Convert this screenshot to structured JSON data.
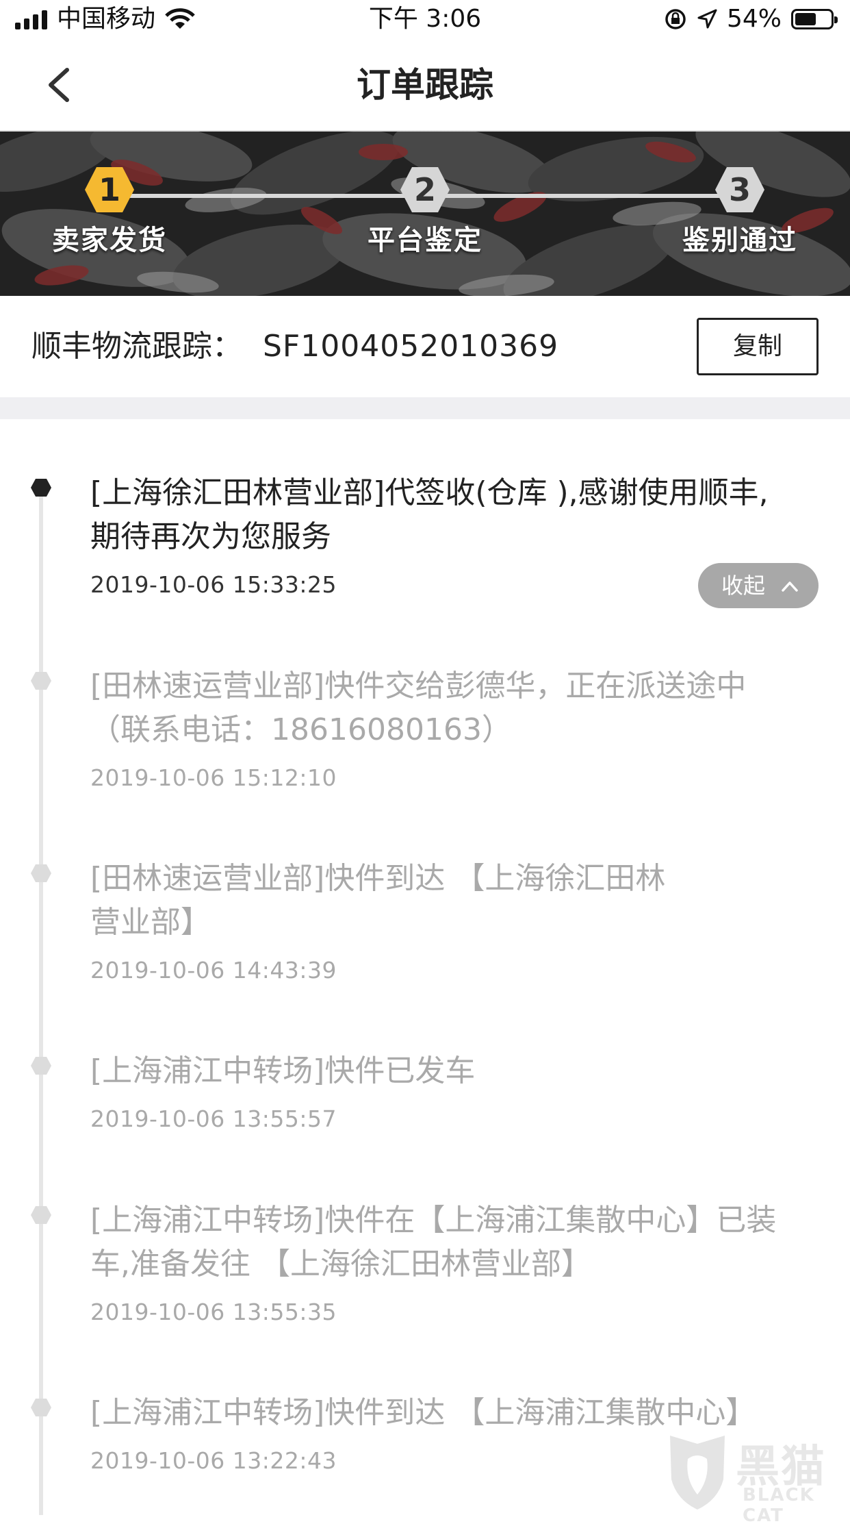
{
  "status_bar": {
    "carrier": "中国移动",
    "time": "下午 3:06",
    "battery": "54%",
    "battery_level": 0.54
  },
  "nav": {
    "title": "订单跟踪",
    "back_icon": "chevron-left-icon"
  },
  "progress": {
    "steps": [
      {
        "number": "1",
        "label": "卖家发货",
        "active": true
      },
      {
        "number": "2",
        "label": "平台鉴定",
        "active": false
      },
      {
        "number": "3",
        "label": "鉴别通过",
        "active": false
      }
    ],
    "active_color": "#f5b931",
    "inactive_color": "#d6d6d6"
  },
  "tracking": {
    "label": "顺丰物流跟踪：",
    "number": "SF1004052010369",
    "copy_label": "复制"
  },
  "collapse": {
    "label": "收起",
    "icon": "chevron-up-icon"
  },
  "events": [
    {
      "text_1": "[上海徐汇田林营业部]代签收(仓库 ),感谢使用顺丰,",
      "text_2": "期待再次为您服务",
      "time": "2019-10-06 15:33:25"
    },
    {
      "text_1": "[田林速运营业部]快件交给彭德华，正在派送途中",
      "text_2": "（联系电话：18616080163）",
      "time": "2019-10-06 15:12:10"
    },
    {
      "text_1": "[田林速运营业部]快件到达 【上海徐汇田林",
      "text_2": "营业部】",
      "time": "2019-10-06 14:43:39"
    },
    {
      "text_1": "[上海浦江中转场]快件已发车",
      "time": "2019-10-06 13:55:57"
    },
    {
      "text_1": "[上海浦江中转场]快件在【上海浦江集散中心】已装",
      "text_2": "车,准备发往 【上海徐汇田林营业部】",
      "time": "2019-10-06 13:55:35"
    },
    {
      "text_1": "[上海浦江中转场]快件到达 【上海浦江集散中心】",
      "time": "2019-10-06 13:22:43"
    }
  ],
  "watermark": {
    "text": "黑猫",
    "sub": "BLACK CAT"
  }
}
